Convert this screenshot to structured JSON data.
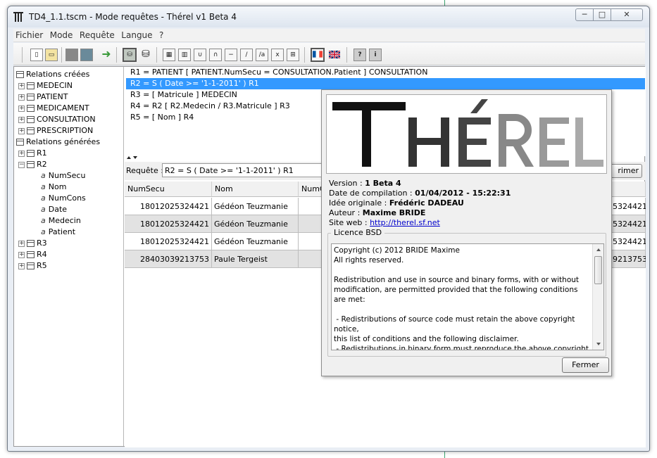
{
  "window": {
    "title": "TD4_1.1.tscm - Mode requêtes - Thérel v1 Beta 4",
    "min_label": "─",
    "max_label": "□",
    "close_label": "✕"
  },
  "menubar": {
    "items": [
      "Fichier",
      "Mode",
      "Requête",
      "Langue",
      "?"
    ]
  },
  "tree": {
    "created_header": "Relations créées",
    "created": [
      "MEDECIN",
      "PATIENT",
      "MEDICAMENT",
      "CONSULTATION",
      "PRESCRIPTION"
    ],
    "generated_header": "Relations générées",
    "generated": [
      "R1",
      "R2",
      "R3",
      "R4",
      "R5"
    ],
    "r2_attributes": [
      "NumSecu",
      "Nom",
      "NumCons",
      "Date",
      "Medecin",
      "Patient"
    ],
    "attr_icon": "a"
  },
  "relations": [
    "R1 = PATIENT [ PATIENT.NumSecu = CONSULTATION.Patient ] CONSULTATION",
    "R2 = S ( Date >= '1-1-2011' ) R1",
    "R3 = [ Matricule ] MEDECIN",
    "R4 = R2 [ R2.Medecin / R3.Matricule ] R3",
    "R5 = [ Nom ] R4"
  ],
  "selected_relation_index": 1,
  "query": {
    "label": "Requête :",
    "value": "R2 = S ( Date >= '1-1-2011' ) R1",
    "button_label": "rimer"
  },
  "results": {
    "columns": [
      "NumSecu",
      "Nom",
      "NumCo"
    ],
    "rows": [
      {
        "numsecu": "18012025324421",
        "nom": "Gédéon Teuzmanie",
        "right": "5324421"
      },
      {
        "numsecu": "18012025324421",
        "nom": "Gédéon Teuzmanie",
        "right": "5324421"
      },
      {
        "numsecu": "18012025324421",
        "nom": "Gédéon Teuzmanie",
        "right": "5324421"
      },
      {
        "numsecu": "28403039213753",
        "nom": "Paule Tergeist",
        "right": "9213753"
      }
    ]
  },
  "about": {
    "logo_text": "THÉREL",
    "version_label": "Version :",
    "version_value": "1 Beta 4",
    "compile_label": "Date de compilation :",
    "compile_value": "01/04/2012 - 15:22:31",
    "idea_label": "Idée originale :",
    "idea_value": "Frédéric DADEAU",
    "author_label": "Auteur :",
    "author_value": "Maxime BRIDE",
    "site_label": "Site web :",
    "site_value": "http://therel.sf.net",
    "licence_title": "Licence BSD",
    "licence_text": "Copyright (c) 2012 BRIDE Maxime\nAll rights reserved.\n\nRedistribution and use in source and binary forms, with or without\nmodification, are permitted provided that the following conditions are met:\n\n - Redistributions of source code must retain the above copyright notice,\nthis list of conditions and the following disclaimer.\n - Redistributions in binary form must reproduce the above copyright\nnotice, this list of conditions and the following disclaimer in the\ndocumentation and/or other materials provided with the distribution.",
    "close_label": "Fermer"
  },
  "colors": {
    "selection": "#3399ff",
    "link": "#0000cc"
  },
  "icons": [
    "new-file-icon",
    "open-folder-icon",
    "save-disabled-icon",
    "save-icon",
    "export-icon",
    "database-relation-icon",
    "database-generated-icon",
    "table-icon",
    "table-columns-icon",
    "union-icon",
    "intersection-icon",
    "difference-icon",
    "division-icon",
    "selection-icon",
    "product-icon",
    "join-icon",
    "flag-french-icon",
    "flag-english-icon",
    "help-icon",
    "info-icon"
  ]
}
